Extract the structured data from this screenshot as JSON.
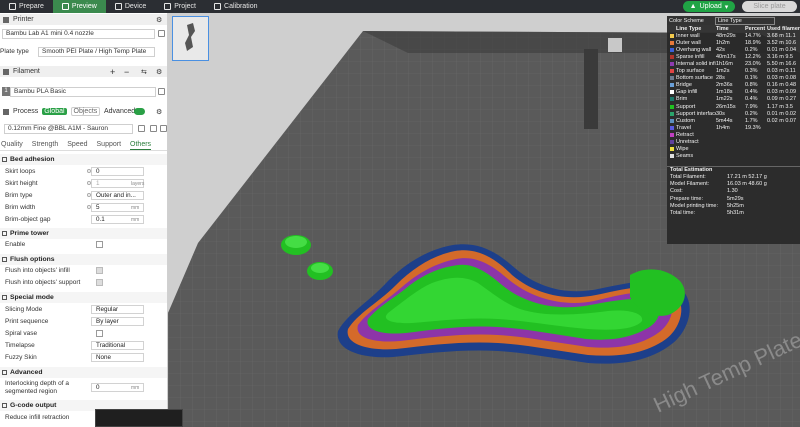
{
  "topbar": {
    "tabs": [
      {
        "label": "Prepare",
        "icon": "cube-icon",
        "active": false
      },
      {
        "label": "Preview",
        "icon": "eye-icon",
        "active": true
      },
      {
        "label": "Device",
        "icon": "printer-icon",
        "active": false
      },
      {
        "label": "Project",
        "icon": "folder-icon",
        "active": false
      },
      {
        "label": "Calibration",
        "icon": "calibration-icon",
        "active": false
      }
    ],
    "upload_label": "Upload",
    "slice_label": "Slice plate"
  },
  "sidebar": {
    "printer_title": "Printer",
    "printer_value": "Bambu Lab A1 mini 0.4 nozzle",
    "plate_type_label": "Plate type",
    "plate_type_value": "Smooth PEI Plate / High Temp Plate",
    "filament_title": "Filament",
    "filament_value": "Bambu PLA Basic",
    "filament_index": "1",
    "process_title": "Process",
    "process_global": "Global",
    "process_objects": "Objects",
    "advanced_label": "Advanced",
    "process_value": "0.12mm Fine @BBL A1M - Sauron",
    "tabs": [
      "Quality",
      "Strength",
      "Speed",
      "Support",
      "Others"
    ],
    "groups": {
      "bed_adhesion": "Bed adhesion",
      "prime_tower": "Prime tower",
      "flush_options": "Flush options",
      "special_mode": "Special mode",
      "advanced": "Advanced",
      "gcode_output": "G-code output"
    },
    "fields": {
      "skirt_loops": {
        "label": "Skirt loops",
        "value": "0"
      },
      "skirt_height": {
        "label": "Skirt height",
        "value": "1",
        "unit": "layers"
      },
      "brim_type": {
        "label": "Brim type",
        "value": "Outer and in..."
      },
      "brim_width": {
        "label": "Brim width",
        "value": "5",
        "unit": "mm"
      },
      "brim_gap": {
        "label": "Brim-object gap",
        "value": "0.1",
        "unit": "mm"
      },
      "enable": {
        "label": "Enable"
      },
      "flush_infill": {
        "label": "Flush into objects' infill"
      },
      "flush_support": {
        "label": "Flush into objects' support"
      },
      "slicing_mode": {
        "label": "Slicing Mode",
        "value": "Regular"
      },
      "print_sequence": {
        "label": "Print sequence",
        "value": "By layer"
      },
      "spiral_vase": {
        "label": "Spiral vase"
      },
      "timelapse": {
        "label": "Timelapse",
        "value": "Traditional"
      },
      "fuzzy_skin": {
        "label": "Fuzzy Skin",
        "value": "None"
      },
      "interlocking": {
        "label_1": "Interlocking depth of a",
        "label_2": "segmented region",
        "value": "0",
        "unit": "mm"
      },
      "reduce_infill": {
        "label": "Reduce infill retraction"
      }
    }
  },
  "legend": {
    "color_scheme_label": "Color Scheme",
    "color_scheme_value": "Line Type",
    "columns": [
      "Line Type",
      "Time",
      "Percent",
      "Used filament"
    ],
    "rows": [
      {
        "name": "Inner wall",
        "time": "48m29s",
        "pct": "14.7%",
        "used": "3.68 m  11.1",
        "color": "#f2c94c"
      },
      {
        "name": "Outer wall",
        "time": "1h2m",
        "pct": "18.9%",
        "used": "3.52 m  10.6",
        "color": "#e8793a"
      },
      {
        "name": "Overhang wall",
        "time": "42s",
        "pct": "0.2%",
        "used": "0.01 m  0.04",
        "color": "#3b5fd9"
      },
      {
        "name": "Sparse infill",
        "time": "40m17s",
        "pct": "12.2%",
        "used": "3.16 m  9.5",
        "color": "#b0332a"
      },
      {
        "name": "Internal solid infill",
        "time": "1h16m",
        "pct": "23.0%",
        "used": "5.50 m  16.6",
        "color": "#8e3bb0"
      },
      {
        "name": "Top surface",
        "time": "1m2s",
        "pct": "0.3%",
        "used": "0.03 m  0.11",
        "color": "#e24545"
      },
      {
        "name": "Bottom surface",
        "time": "28s",
        "pct": "0.1%",
        "used": "0.03 m  0.08",
        "color": "#6d7b8f"
      },
      {
        "name": "Bridge",
        "time": "2m36s",
        "pct": "0.8%",
        "used": "0.16 m  0.48",
        "color": "#6aa0d8"
      },
      {
        "name": "Gap infill",
        "time": "1m18s",
        "pct": "0.4%",
        "used": "0.03 m  0.09",
        "color": "#ffffff"
      },
      {
        "name": "Brim",
        "time": "1m22s",
        "pct": "0.4%",
        "used": "0.09 m  0.27",
        "color": "#1a7a6a"
      },
      {
        "name": "Support",
        "time": "26m15s",
        "pct": "7.9%",
        "used": "1.17 m  3.5",
        "color": "#20c020"
      },
      {
        "name": "Support interface",
        "time": "30s",
        "pct": "0.2%",
        "used": "0.01 m  0.02",
        "color": "#2aa36b"
      },
      {
        "name": "Custom",
        "time": "5m44s",
        "pct": "1.7%",
        "used": "0.02 m  0.07",
        "color": "#5d8fbf"
      },
      {
        "name": "Travel",
        "time": "1h4m",
        "pct": "19.3%",
        "used": "",
        "color": "#5a5ae0"
      },
      {
        "name": "Retract",
        "time": "",
        "pct": "",
        "used": "",
        "color": "#c040c0"
      },
      {
        "name": "Unretract",
        "time": "",
        "pct": "",
        "used": "",
        "color": "#6040a0"
      },
      {
        "name": "Wipe",
        "time": "",
        "pct": "",
        "used": "",
        "color": "#f0e040"
      },
      {
        "name": "Seams",
        "time": "",
        "pct": "",
        "used": "",
        "color": "#e0e0e0"
      }
    ],
    "estimation_title": "Total Estimation",
    "estimation": [
      {
        "k": "Total Filament:",
        "v": "17.21 m    52.17 g"
      },
      {
        "k": "Model Filament:",
        "v": "16.03 m    48.60 g"
      },
      {
        "k": "Cost:",
        "v": "1.30"
      },
      {
        "k": "Prepare time:",
        "v": "5m29s"
      },
      {
        "k": "Model printing time:",
        "v": "5h25m"
      },
      {
        "k": "Total time:",
        "v": "5h31m"
      }
    ]
  },
  "viewport": {
    "plate_text": "High Temp Plate"
  }
}
